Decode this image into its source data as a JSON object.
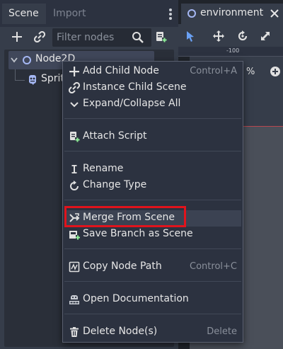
{
  "scene_dock": {
    "tabs": [
      {
        "label": "Scene"
      },
      {
        "label": "Import"
      }
    ],
    "filter": {
      "placeholder": "Filter nodes",
      "value": ""
    },
    "tree": {
      "root": {
        "label": "Node2D",
        "icon": "node2d-icon"
      },
      "children": [
        {
          "label": "Sprite",
          "icon": "sprite-icon"
        }
      ]
    }
  },
  "editor": {
    "tab": {
      "label": "environment"
    },
    "ruler_label": "-100",
    "zoom_label": "%"
  },
  "context_menu": {
    "items": [
      {
        "label": "Add Child Node",
        "shortcut": "Control+A",
        "icon": "add-icon"
      },
      {
        "label": "Instance Child Scene",
        "shortcut": "",
        "icon": "link-icon"
      },
      {
        "label": "Expand/Collapse All",
        "shortcut": "",
        "icon": "chevron-down-icon"
      },
      {
        "label": "Attach Script",
        "shortcut": "",
        "icon": "script-add-icon"
      },
      {
        "label": "Rename",
        "shortcut": "",
        "icon": "text-cursor-icon"
      },
      {
        "label": "Change Type",
        "shortcut": "",
        "icon": "rotate-icon"
      },
      {
        "label": "Merge From Scene",
        "shortcut": "",
        "icon": "merge-icon"
      },
      {
        "label": "Save Branch as Scene",
        "shortcut": "",
        "icon": "save-branch-icon"
      },
      {
        "label": "Copy Node Path",
        "shortcut": "Control+C",
        "icon": "copy-path-icon"
      },
      {
        "label": "Open Documentation",
        "shortcut": "",
        "icon": "documentation-icon"
      },
      {
        "label": "Delete Node(s)",
        "shortcut": "Delete",
        "icon": "trash-icon"
      }
    ],
    "highlighted_item": "Merge From Scene",
    "highlight_color": "#e1131c"
  },
  "colors": {
    "accent": "#a5b7f3",
    "selection_background": "#40475a",
    "menu_background": "#2c3240"
  }
}
